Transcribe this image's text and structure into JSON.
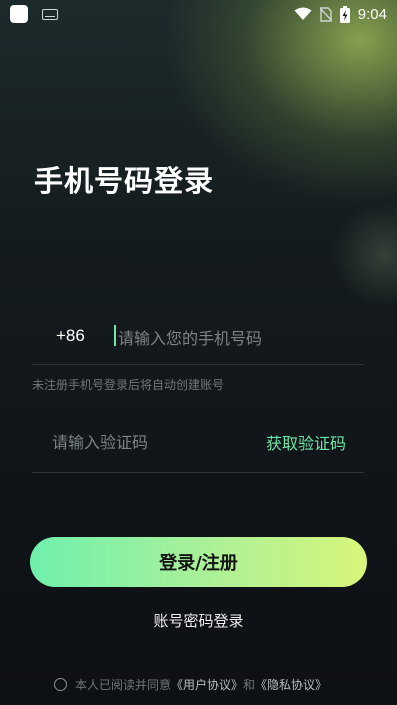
{
  "status_bar": {
    "time": "9:04"
  },
  "page": {
    "title": "手机号码登录"
  },
  "phone": {
    "country_code": "+86",
    "placeholder": "请输入您的手机号码",
    "value": ""
  },
  "hint": "未注册手机号登录后将自动创建账号",
  "code": {
    "placeholder": "请输入验证码",
    "value": "",
    "get_code_label": "获取验证码"
  },
  "login_button": "登录/注册",
  "password_login": "账号密码登录",
  "agreement": {
    "prefix": "本人已阅读并同意",
    "user_agreement": "《用户协议》",
    "and": "和",
    "privacy_agreement": "《隐私协议》"
  },
  "colors": {
    "accent": "#6fe6a6",
    "button_gradient_start": "#6ff0ad",
    "button_gradient_end": "#d8f57a"
  }
}
